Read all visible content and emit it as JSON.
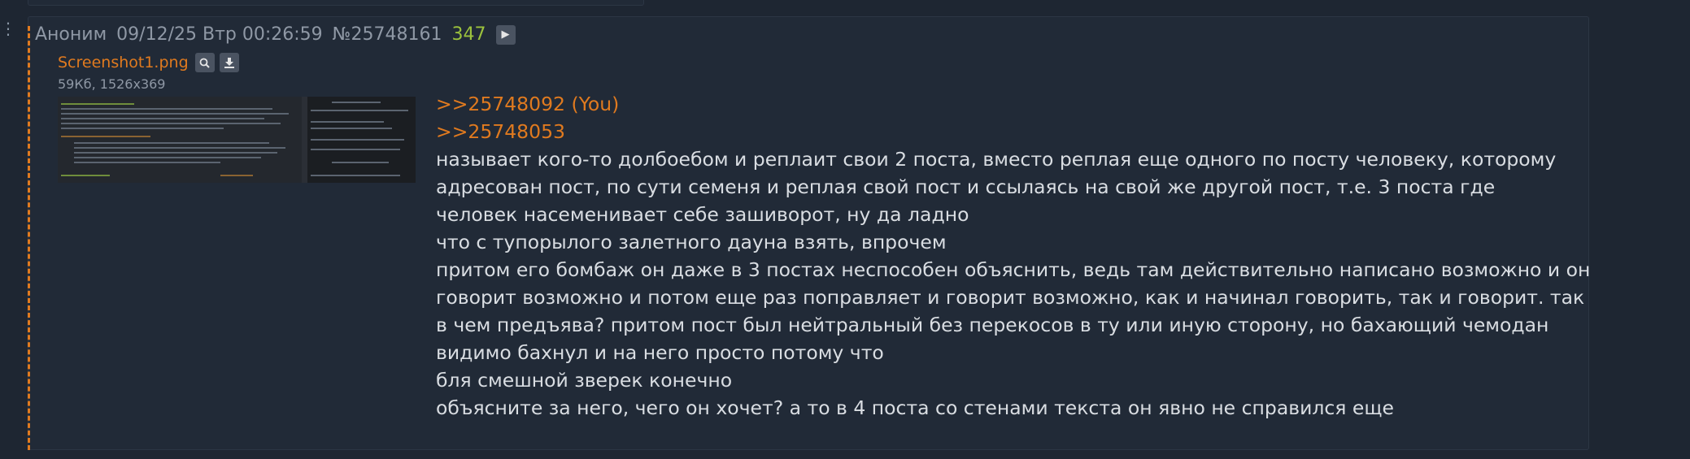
{
  "post": {
    "author": "Аноним",
    "date": "09/12/25 Втр 00:26:59",
    "number": "№25748161",
    "reply_count": "347",
    "play_icon": "play-icon",
    "file": {
      "name": "Screenshot1.png",
      "size": "59Кб, 1526x369",
      "search_icon": "search-icon",
      "download_icon": "download-icon"
    },
    "quotes": [
      ">>25748092 (You)",
      ">>25748053"
    ],
    "lines": [
      "называет кого-то долбоебом и реплаит свои 2 поста, вместо реплая еще одного по посту человеку, которому",
      "адресован пост, по сути семеня и реплая свой пост и ссылаясь на свой же другой пост, т.е. 3 поста где",
      "человек насеменивает себе зашиворот, ну да ладно",
      "что с тупорылого залетного дауна взять, впрочем",
      "притом его бомбаж он даже в 3 постах неспособен объяснить, ведь там действительно написано возможно и он",
      "говорит возможно и потом еще раз поправляет и говорит возможно, как и начинал говорить, так и говорит. так",
      "в чем предъява? притом пост был нейтральный без перекосов в ту или иную сторону, но бахающий чемодан",
      "видимо бахнул и на него просто потому что",
      "бля смешной зверек конечно",
      "объясните за него, чего он хочет? а то в 4 поста со стенами текста он явно не справился еще"
    ]
  },
  "colors": {
    "background": "#1e2632",
    "post_bg": "#212a37",
    "accent": "#e07a1f",
    "reply_count": "#9cc23d",
    "text": "#d9dde2",
    "meta": "#8f98a5"
  }
}
